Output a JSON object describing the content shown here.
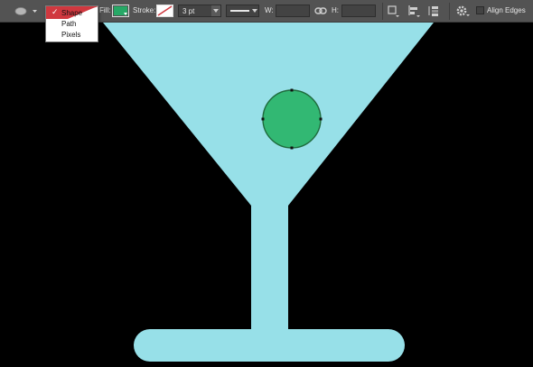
{
  "options_bar": {
    "fill_label": "Fill:",
    "fill_color": "#27a866",
    "stroke_label": "Stroke:",
    "stroke_width": "3 pt",
    "width_label": "W:",
    "width_value": "",
    "height_label": "H:",
    "height_value": "",
    "align_edges_label": "Align Edges",
    "align_edges_checked": false
  },
  "tool_mode_menu": {
    "items": [
      {
        "label": "Shape",
        "selected": true
      },
      {
        "label": "Path",
        "selected": false
      },
      {
        "label": "Pixels",
        "selected": false
      }
    ],
    "check_glyph": "✓"
  },
  "canvas": {
    "background": "#000000",
    "glass_color": "#97e0e8",
    "olive_color": "#32b873",
    "olive_stroke": "#1f6b3d",
    "menu_highlight": "#d0383f"
  }
}
